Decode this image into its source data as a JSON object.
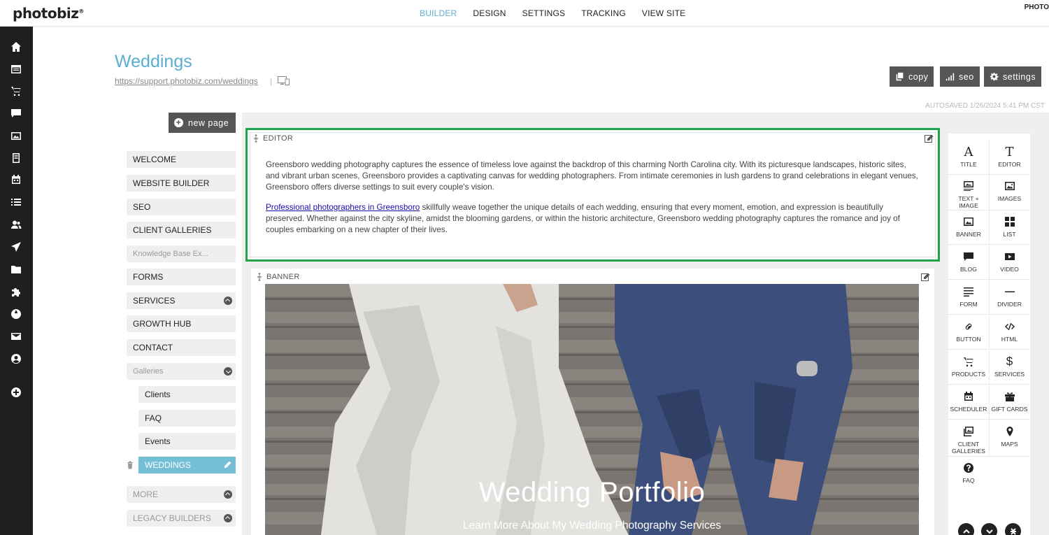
{
  "brand": {
    "logo": "photobiz",
    "account": "PHOTO"
  },
  "topnav": [
    {
      "label": "BUILDER",
      "active": true
    },
    {
      "label": "DESIGN",
      "active": false
    },
    {
      "label": "SETTINGS",
      "active": false
    },
    {
      "label": "TRACKING",
      "active": false
    },
    {
      "label": "VIEW SITE",
      "active": false
    }
  ],
  "rail_icons": [
    "home-icon",
    "calendar-list-icon",
    "cart-icon",
    "chat-icon",
    "image-icon",
    "document-icon",
    "scheduler-icon",
    "list-icon",
    "users-icon",
    "send-icon",
    "folder-icon",
    "puzzle-icon",
    "globe-icon",
    "mail-icon",
    "account-icon",
    "add-circle-icon"
  ],
  "page": {
    "title": "Weddings",
    "url": "https://support.photobiz.com/weddings",
    "url_separator": "|",
    "autosaved": "AUTOSAVED 1/26/2024 5:41 PM CST"
  },
  "header_buttons": {
    "copy": "copy",
    "seo": "seo",
    "settings": "settings"
  },
  "new_page": "new page",
  "page_list": {
    "welcome": "WELCOME",
    "website_builder": "WEBSITE BUILDER",
    "seo": "SEO",
    "client_galleries": "CLIENT GALLERIES",
    "knowledge_base": "Knowledge Base Ex...",
    "forms": "FORMS",
    "services": "SERVICES",
    "growth_hub": "GROWTH HUB",
    "contact": "CONTACT",
    "galleries": "Galleries",
    "clients": "Clients",
    "faq": "FAQ",
    "events": "Events",
    "weddings": "WEDDINGS",
    "more": "MORE",
    "legacy_builders": "LEGACY BUILDERS"
  },
  "editor_block": {
    "label": "EDITOR",
    "p1": "Greensboro wedding photography captures the essence of timeless love against the backdrop of this charming North Carolina city. With its picturesque landscapes, historic sites, and vibrant urban scenes, Greensboro provides a captivating canvas for wedding photographers. From intimate ceremonies in lush gardens to grand celebrations in elegant venues, Greensboro offers diverse settings to suit every couple's vision.",
    "link": "Professional photographers in Greensboro",
    "p2_rest": " skillfully weave together the unique details of each wedding, ensuring that every moment, emotion, and expression is beautifully preserved. Whether against the city skyline, amidst the blooming gardens, or within the historic architecture, Greensboro wedding photography captures the romance and joy of couples embarking on a new chapter of their lives."
  },
  "banner_block": {
    "label": "BANNER",
    "title": "Wedding Portfolio",
    "subtitle": "Learn More About My Wedding Photography Services"
  },
  "widgets": {
    "title": "TITLE",
    "editor": "EDITOR",
    "text_image": "TEXT + IMAGE",
    "images": "IMAGES",
    "banner": "BANNER",
    "list": "LIST",
    "blog": "BLOG",
    "video": "VIDEO",
    "form": "FORM",
    "divider": "DIVIDER",
    "button": "BUTTON",
    "html": "HTML",
    "products": "PRODUCTS",
    "services": "SERVICES",
    "scheduler": "SCHEDULER",
    "gift_cards": "GIFT CARDS",
    "client_galleries": "CLIENT GALLERIES",
    "maps": "MAPS",
    "faq": "FAQ"
  },
  "colors": {
    "accent": "#5aaed1",
    "active_page": "#74bed6",
    "selected_outline": "#21a34a",
    "rail": "#1f1f1f",
    "button": "#555555"
  }
}
